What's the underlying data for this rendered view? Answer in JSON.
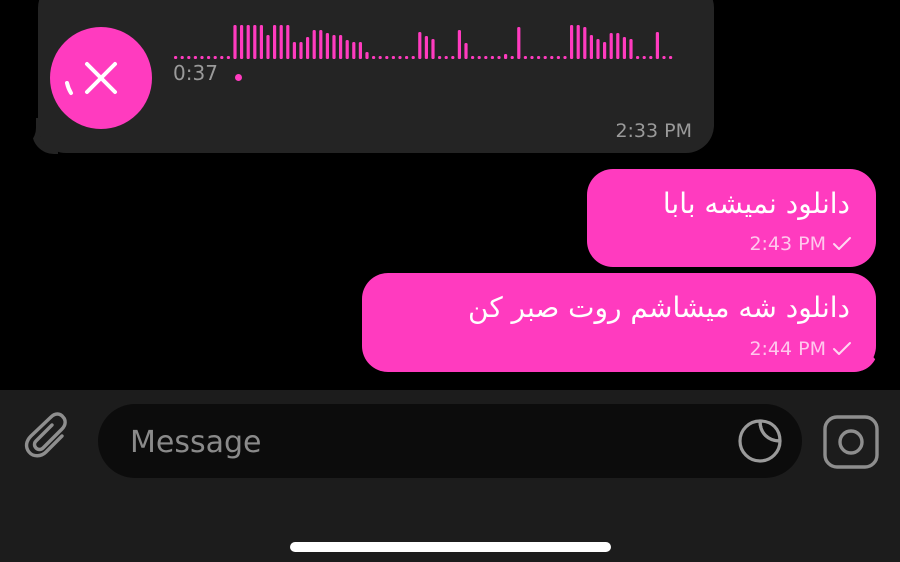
{
  "voice_message": {
    "duration": "0:37",
    "time": "2:33 PM",
    "cancel_icon": "close-icon",
    "waveform_heights": [
      3,
      3,
      3,
      3,
      3,
      3,
      3,
      3,
      3,
      34,
      34,
      34,
      34,
      34,
      24,
      34,
      34,
      34,
      17,
      17,
      22,
      29,
      29,
      26,
      24,
      24,
      19,
      17,
      17,
      7,
      3,
      3,
      3,
      3,
      3,
      3,
      3,
      27,
      23,
      20,
      3,
      3,
      3,
      29,
      16,
      3,
      3,
      3,
      3,
      3,
      5,
      3,
      32,
      3,
      3,
      3,
      3,
      3,
      3,
      3,
      34,
      34,
      32,
      24,
      20,
      17,
      26,
      26,
      22,
      20,
      3,
      3,
      3,
      27,
      3,
      3
    ]
  },
  "messages": [
    {
      "text": "دانلود نمیشه بابا",
      "time": "2:43 PM",
      "status": "sent"
    },
    {
      "text": "دانلود شه میشاشم روت صبر کن",
      "time": "2:44 PM",
      "status": "sent"
    }
  ],
  "input": {
    "placeholder": "Message"
  },
  "icons": {
    "attach": "paperclip-icon",
    "sticker": "sticker-icon",
    "camera": "camera-icon",
    "read_check": "check-icon"
  },
  "colors": {
    "accent": "#ff3bbf",
    "incoming_bubble": "#242424",
    "background": "#000000",
    "input_bar": "#1c1c1c"
  }
}
